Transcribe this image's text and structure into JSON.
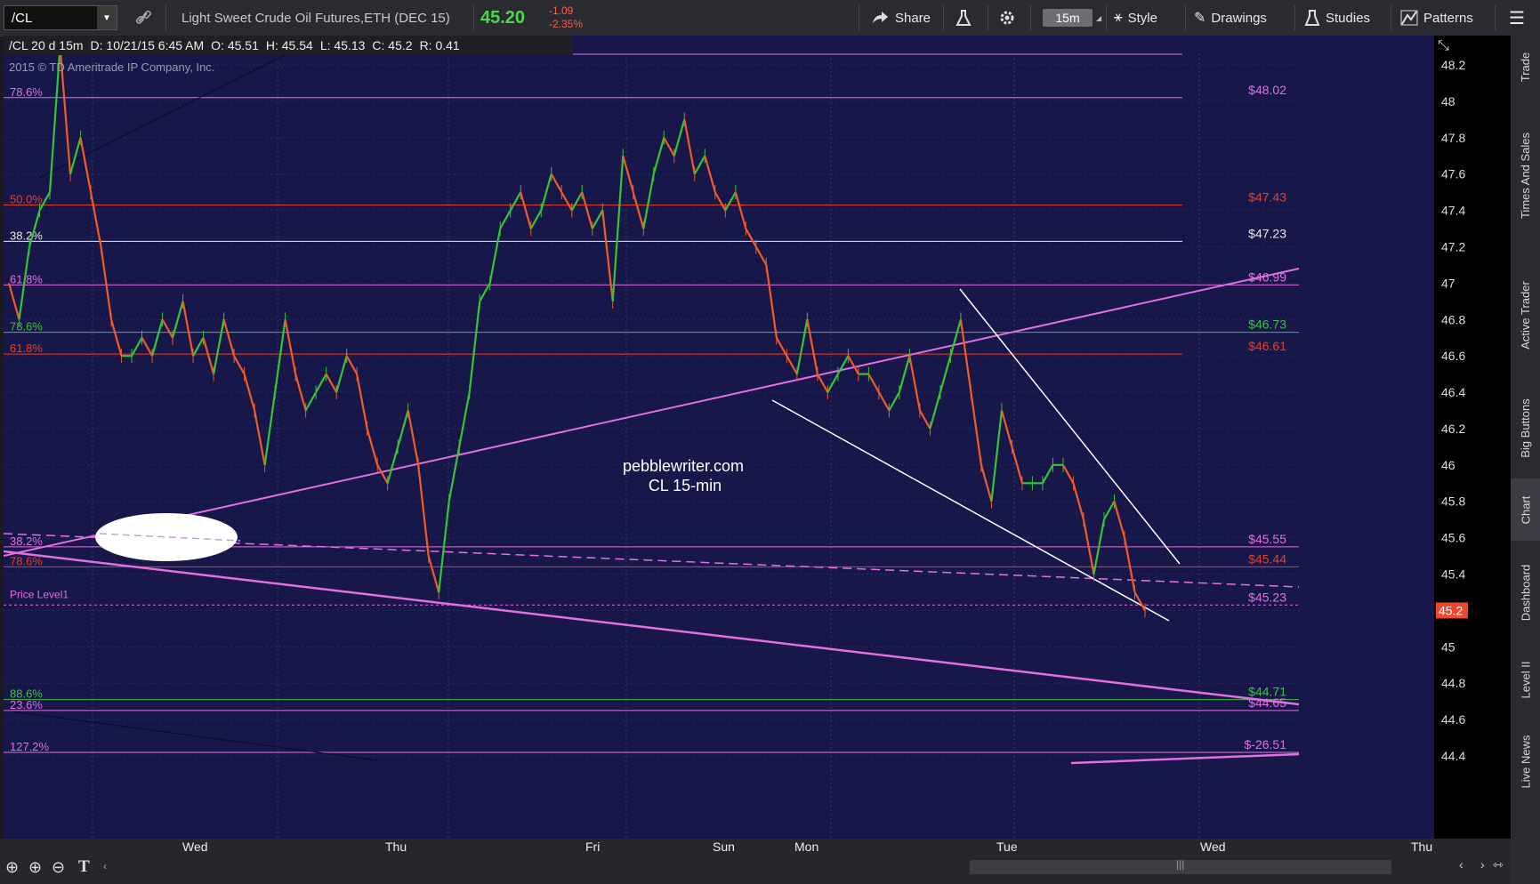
{
  "toolbar": {
    "symbol": "/CL",
    "description": "Light Sweet Crude Oil Futures,ETH (DEC 15)",
    "last_price": "45.20",
    "change": "-1.09",
    "change_pct": "-2.35%",
    "share": "Share",
    "timeframe": "15m",
    "style": "Style",
    "drawings": "Drawings",
    "studies": "Studies",
    "patterns": "Patterns"
  },
  "infobar": {
    "name": "/CL 20 d 15m",
    "date": "D: 10/21/15 6:45 AM",
    "open": "O: 45.51",
    "high": "H: 45.54",
    "low": "L: 45.13",
    "close": "C: 45.2",
    "range": "R: 0.41"
  },
  "copyright": "2015 © TD Ameritrade IP Company, Inc.",
  "watermark": [
    "pebblewriter.com",
    "CL 15-min"
  ],
  "price_level_label": "Price Level1",
  "current_price_tag": "45.2",
  "sidepanel": [
    "Trade",
    "Times And Sales",
    "Active Trader",
    "Big Buttons",
    "Chart",
    "Dashboard",
    "Level II",
    "Live News"
  ],
  "chart_data": {
    "type": "line",
    "instrument": "/CL 15m",
    "x_labels": [
      "Wed",
      "Thu",
      "Fri",
      "Sun",
      "Mon",
      "Tue",
      "Wed",
      "Thu"
    ],
    "y_ticks": [
      "48.2",
      "48",
      "47.8",
      "47.6",
      "47.4",
      "47.2",
      "47",
      "46.8",
      "46.6",
      "46.4",
      "46.2",
      "46",
      "45.8",
      "45.6",
      "45.4",
      "45.2",
      "45",
      "44.8",
      "44.6",
      "44.4"
    ],
    "ylim": [
      44.4,
      48.3
    ],
    "fib_lines": [
      {
        "left": "78.6%",
        "right": "$48.02",
        "color": "#e070e0"
      },
      {
        "left": "50.0%",
        "right": "$47.43",
        "color": "#e0402a"
      },
      {
        "left": "38.2%",
        "right": "$47.23",
        "color": "#e8e8e8"
      },
      {
        "left": "61.8%",
        "right": "$46.99",
        "color": "#e070e0"
      },
      {
        "left": "78.6%",
        "right": "$46.73",
        "color": "#40c040"
      },
      {
        "left": "61.8%",
        "right": "$46.61",
        "color": "#e0402a"
      },
      {
        "left": "38.2%",
        "right": "$45.55",
        "color": "#e070e0"
      },
      {
        "left": "78.6%",
        "right": "$45.44",
        "color": "#e0402a"
      },
      {
        "left": "",
        "right": "$45.23",
        "color": "#e070e0"
      },
      {
        "left": "88.6%",
        "right": "$44.71",
        "color": "#40c040"
      },
      {
        "left": "23.6%",
        "right": "$44.65",
        "color": "#e070e0"
      },
      {
        "left": "127.2%",
        "right": "$-26.51",
        "color": "#e070e0"
      }
    ],
    "close_series": [
      47.0,
      46.8,
      47.2,
      47.4,
      47.5,
      48.3,
      47.6,
      47.8,
      47.5,
      47.2,
      46.8,
      46.6,
      46.6,
      46.7,
      46.6,
      46.8,
      46.7,
      46.9,
      46.6,
      46.7,
      46.5,
      46.8,
      46.6,
      46.5,
      46.3,
      46.0,
      46.4,
      46.8,
      46.5,
      46.3,
      46.4,
      46.5,
      46.4,
      46.6,
      46.5,
      46.2,
      46.0,
      45.9,
      46.1,
      46.3,
      46.0,
      45.5,
      45.3,
      45.8,
      46.1,
      46.4,
      46.9,
      47.0,
      47.3,
      47.4,
      47.5,
      47.3,
      47.4,
      47.6,
      47.5,
      47.4,
      47.5,
      47.3,
      47.4,
      46.9,
      47.7,
      47.5,
      47.3,
      47.6,
      47.8,
      47.7,
      47.9,
      47.6,
      47.7,
      47.5,
      47.4,
      47.5,
      47.3,
      47.2,
      47.1,
      46.7,
      46.6,
      46.5,
      46.8,
      46.5,
      46.4,
      46.5,
      46.6,
      46.5,
      46.5,
      46.4,
      46.3,
      46.4,
      46.6,
      46.3,
      46.2,
      46.4,
      46.6,
      46.8,
      46.4,
      46.0,
      45.8,
      46.3,
      46.1,
      45.9,
      45.9,
      45.9,
      46.0,
      46.0,
      45.9,
      45.7,
      45.4,
      45.7,
      45.8,
      45.6,
      45.3,
      45.2
    ],
    "trendlines": [
      {
        "name": "rising-magenta",
        "color": "#e070e0"
      },
      {
        "name": "falling-magenta",
        "color": "#e070e0"
      },
      {
        "name": "wedge-upper",
        "color": "#ffffff"
      },
      {
        "name": "wedge-lower",
        "color": "#ffffff"
      },
      {
        "name": "dashed-magenta",
        "color": "#e070e0"
      }
    ]
  }
}
